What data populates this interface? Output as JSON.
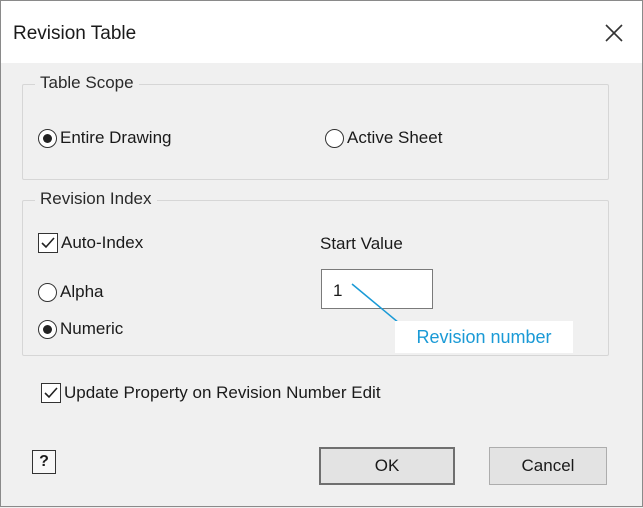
{
  "dialog": {
    "title": "Revision Table",
    "close_icon": "close-icon"
  },
  "table_scope": {
    "title": "Table Scope",
    "options": [
      {
        "label": "Entire Drawing",
        "selected": true
      },
      {
        "label": "Active Sheet",
        "selected": false
      }
    ]
  },
  "revision_index": {
    "title": "Revision Index",
    "auto_index": {
      "label": "Auto-Index",
      "checked": true
    },
    "alpha": {
      "label": "Alpha",
      "selected": false
    },
    "numeric": {
      "label": "Numeric",
      "selected": true
    },
    "start_value_label": "Start Value",
    "start_value": "1"
  },
  "callout": {
    "text": "Revision number",
    "color": "#1a9ad6"
  },
  "update_property": {
    "label": "Update Property on Revision Number Edit",
    "checked": true
  },
  "buttons": {
    "help_icon": "help-icon",
    "help_glyph": "?",
    "ok": "OK",
    "cancel": "Cancel"
  }
}
